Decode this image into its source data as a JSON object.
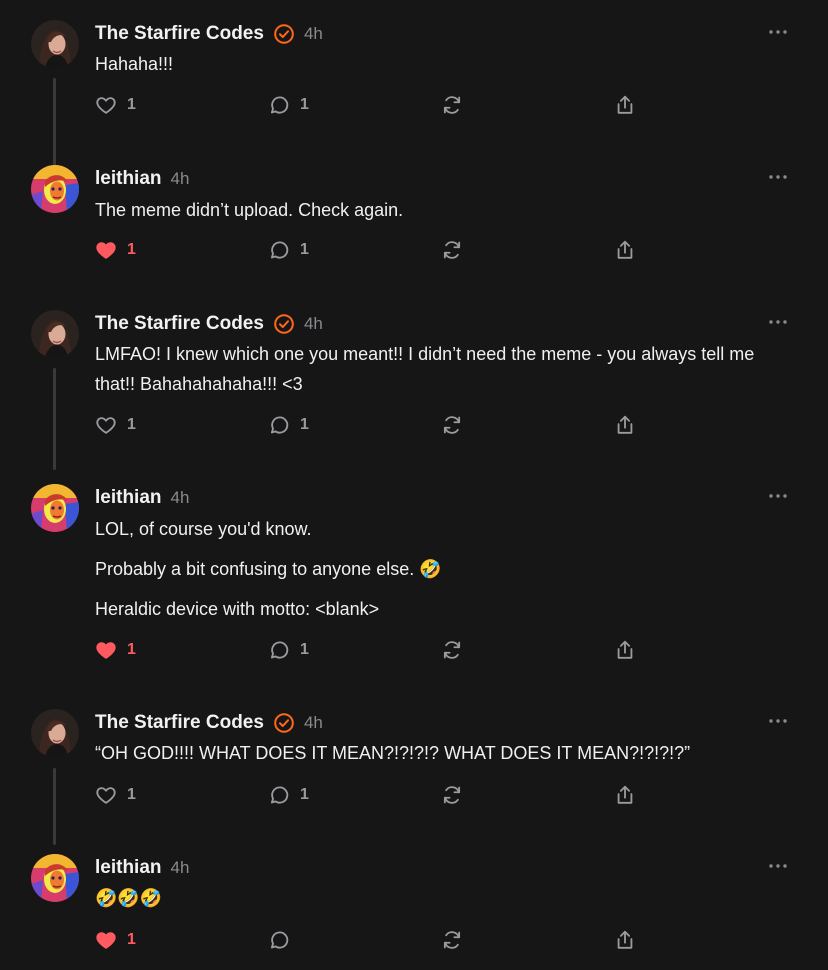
{
  "posts": [
    {
      "author": "The Starfire Codes",
      "verified": true,
      "time": "4h",
      "paragraphs": [
        "Hahaha!!!"
      ],
      "likes": "1",
      "liked": false,
      "replies": "1",
      "avatar": "starfire"
    },
    {
      "author": "leithian",
      "verified": false,
      "time": "4h",
      "paragraphs": [
        "The meme didn’t upload. Check again."
      ],
      "likes": "1",
      "liked": true,
      "replies": "1",
      "avatar": "leithian"
    },
    {
      "author": "The Starfire Codes",
      "verified": true,
      "time": "4h",
      "paragraphs": [
        "LMFAO! I knew which one you meant!! I didn’t need the meme - you always tell me that!! Bahahahahaha!!! <3"
      ],
      "likes": "1",
      "liked": false,
      "replies": "1",
      "avatar": "starfire"
    },
    {
      "author": "leithian",
      "verified": false,
      "time": "4h",
      "paragraphs": [
        "LOL, of course you'd know.",
        "Probably a bit confusing to anyone else. 🤣",
        "Heraldic device with motto: <blank>"
      ],
      "likes": "1",
      "liked": true,
      "replies": "1",
      "avatar": "leithian"
    },
    {
      "author": "The Starfire Codes",
      "verified": true,
      "time": "4h",
      "paragraphs": [
        "“OH GOD!!!! WHAT DOES IT MEAN?!?!?!? WHAT DOES IT MEAN?!?!?!?”"
      ],
      "likes": "1",
      "liked": false,
      "replies": "1",
      "avatar": "starfire"
    },
    {
      "author": "leithian",
      "verified": false,
      "time": "4h",
      "paragraphs": [
        "🤣🤣🤣"
      ],
      "likes": "1",
      "liked": true,
      "replies": "",
      "avatar": "leithian"
    }
  ],
  "icons": {
    "like": "heart-icon",
    "reply": "comment-icon",
    "restack": "restack-icon",
    "share": "share-icon",
    "more": "more-icon",
    "verified": "verified-badge-icon"
  },
  "colors": {
    "background": "#161617",
    "liked": "#ff5a5f",
    "verified": "#ff6719",
    "muted": "#9b9b9f"
  }
}
